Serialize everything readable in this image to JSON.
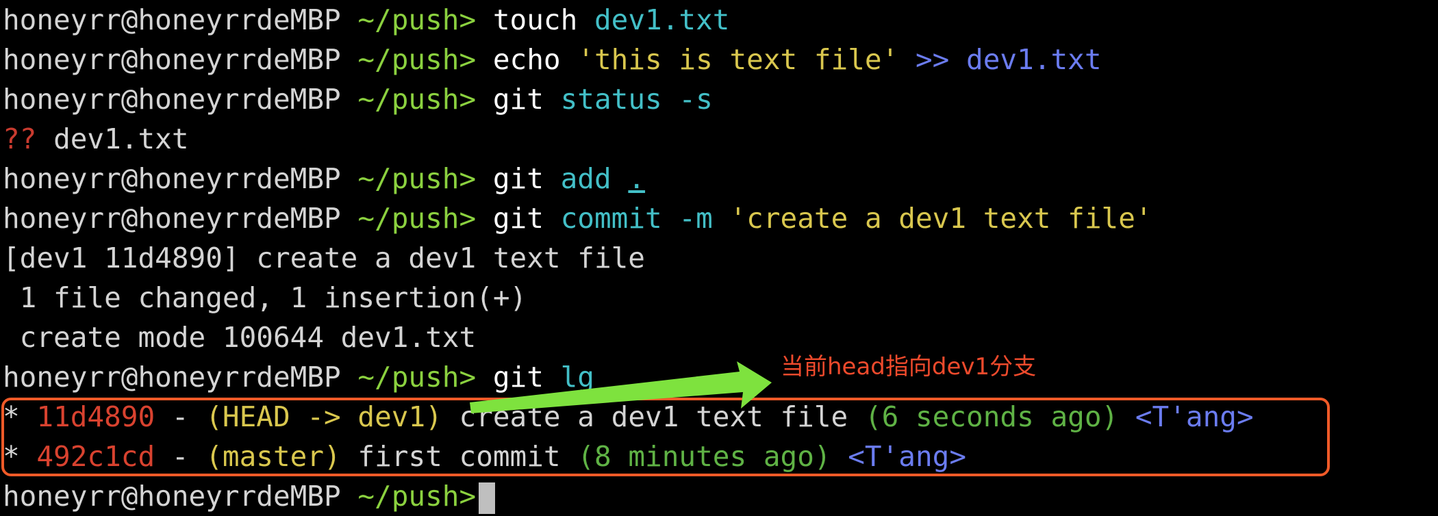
{
  "prompt": {
    "user": "honeyrr@honeyrrdeMBP",
    "path": "~/push>"
  },
  "lines": [
    {
      "cmd": "touch",
      "arg1": "dev1.txt"
    },
    {
      "cmd": "echo",
      "str": "'this is text file'",
      "redir": ">>",
      "file": "dev1.txt"
    },
    {
      "cmd": "git",
      "sub": "status",
      "flag": "-s"
    },
    {
      "status": "??",
      "file": "dev1.txt"
    },
    {
      "cmd": "git",
      "sub": "add",
      "arg": "."
    },
    {
      "cmd": "git",
      "sub": "commit",
      "flag": "-m",
      "msg": "'create a dev1 text file'"
    },
    {
      "out": "[dev1 11d4890] create a dev1 text file"
    },
    {
      "out": " 1 file changed, 1 insertion(+)"
    },
    {
      "out": " create mode 100644 dev1.txt"
    },
    {
      "cmd": "git",
      "sub": "lg"
    }
  ],
  "log": [
    {
      "star": "*",
      "hash": "11d4890",
      "dash": " - ",
      "ref": "(HEAD -> dev1)",
      "msg": " create a dev1 text file ",
      "time": "(6 seconds ago)",
      "author": "<T'ang>"
    },
    {
      "star": "*",
      "hash": "492c1cd",
      "dash": " - ",
      "ref": "(master)",
      "msg": " first commit ",
      "time": "(8 minutes ago)",
      "author": "<T'ang>"
    }
  ],
  "annotation": {
    "text": "当前head指向dev1分支"
  },
  "colors": {
    "highlight_box": "#f05a28",
    "arrow": "#7ee23e",
    "annotation": "#ee4a2c"
  }
}
